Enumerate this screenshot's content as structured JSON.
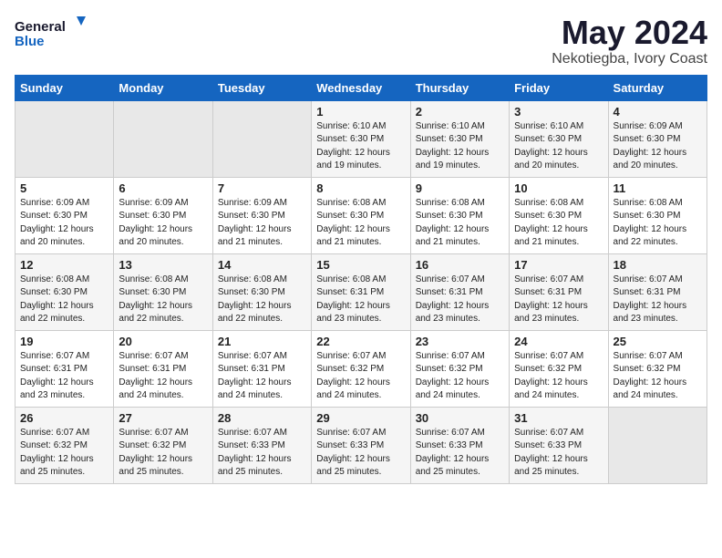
{
  "header": {
    "logo_line1": "General",
    "logo_line2": "Blue",
    "month": "May 2024",
    "location": "Nekotiegba, Ivory Coast"
  },
  "days_of_week": [
    "Sunday",
    "Monday",
    "Tuesday",
    "Wednesday",
    "Thursday",
    "Friday",
    "Saturday"
  ],
  "weeks": [
    [
      {
        "day": "",
        "text": ""
      },
      {
        "day": "",
        "text": ""
      },
      {
        "day": "",
        "text": ""
      },
      {
        "day": "1",
        "text": "Sunrise: 6:10 AM\nSunset: 6:30 PM\nDaylight: 12 hours\nand 19 minutes."
      },
      {
        "day": "2",
        "text": "Sunrise: 6:10 AM\nSunset: 6:30 PM\nDaylight: 12 hours\nand 19 minutes."
      },
      {
        "day": "3",
        "text": "Sunrise: 6:10 AM\nSunset: 6:30 PM\nDaylight: 12 hours\nand 20 minutes."
      },
      {
        "day": "4",
        "text": "Sunrise: 6:09 AM\nSunset: 6:30 PM\nDaylight: 12 hours\nand 20 minutes."
      }
    ],
    [
      {
        "day": "5",
        "text": "Sunrise: 6:09 AM\nSunset: 6:30 PM\nDaylight: 12 hours\nand 20 minutes."
      },
      {
        "day": "6",
        "text": "Sunrise: 6:09 AM\nSunset: 6:30 PM\nDaylight: 12 hours\nand 20 minutes."
      },
      {
        "day": "7",
        "text": "Sunrise: 6:09 AM\nSunset: 6:30 PM\nDaylight: 12 hours\nand 21 minutes."
      },
      {
        "day": "8",
        "text": "Sunrise: 6:08 AM\nSunset: 6:30 PM\nDaylight: 12 hours\nand 21 minutes."
      },
      {
        "day": "9",
        "text": "Sunrise: 6:08 AM\nSunset: 6:30 PM\nDaylight: 12 hours\nand 21 minutes."
      },
      {
        "day": "10",
        "text": "Sunrise: 6:08 AM\nSunset: 6:30 PM\nDaylight: 12 hours\nand 21 minutes."
      },
      {
        "day": "11",
        "text": "Sunrise: 6:08 AM\nSunset: 6:30 PM\nDaylight: 12 hours\nand 22 minutes."
      }
    ],
    [
      {
        "day": "12",
        "text": "Sunrise: 6:08 AM\nSunset: 6:30 PM\nDaylight: 12 hours\nand 22 minutes."
      },
      {
        "day": "13",
        "text": "Sunrise: 6:08 AM\nSunset: 6:30 PM\nDaylight: 12 hours\nand 22 minutes."
      },
      {
        "day": "14",
        "text": "Sunrise: 6:08 AM\nSunset: 6:30 PM\nDaylight: 12 hours\nand 22 minutes."
      },
      {
        "day": "15",
        "text": "Sunrise: 6:08 AM\nSunset: 6:31 PM\nDaylight: 12 hours\nand 23 minutes."
      },
      {
        "day": "16",
        "text": "Sunrise: 6:07 AM\nSunset: 6:31 PM\nDaylight: 12 hours\nand 23 minutes."
      },
      {
        "day": "17",
        "text": "Sunrise: 6:07 AM\nSunset: 6:31 PM\nDaylight: 12 hours\nand 23 minutes."
      },
      {
        "day": "18",
        "text": "Sunrise: 6:07 AM\nSunset: 6:31 PM\nDaylight: 12 hours\nand 23 minutes."
      }
    ],
    [
      {
        "day": "19",
        "text": "Sunrise: 6:07 AM\nSunset: 6:31 PM\nDaylight: 12 hours\nand 23 minutes."
      },
      {
        "day": "20",
        "text": "Sunrise: 6:07 AM\nSunset: 6:31 PM\nDaylight: 12 hours\nand 24 minutes."
      },
      {
        "day": "21",
        "text": "Sunrise: 6:07 AM\nSunset: 6:31 PM\nDaylight: 12 hours\nand 24 minutes."
      },
      {
        "day": "22",
        "text": "Sunrise: 6:07 AM\nSunset: 6:32 PM\nDaylight: 12 hours\nand 24 minutes."
      },
      {
        "day": "23",
        "text": "Sunrise: 6:07 AM\nSunset: 6:32 PM\nDaylight: 12 hours\nand 24 minutes."
      },
      {
        "day": "24",
        "text": "Sunrise: 6:07 AM\nSunset: 6:32 PM\nDaylight: 12 hours\nand 24 minutes."
      },
      {
        "day": "25",
        "text": "Sunrise: 6:07 AM\nSunset: 6:32 PM\nDaylight: 12 hours\nand 24 minutes."
      }
    ],
    [
      {
        "day": "26",
        "text": "Sunrise: 6:07 AM\nSunset: 6:32 PM\nDaylight: 12 hours\nand 25 minutes."
      },
      {
        "day": "27",
        "text": "Sunrise: 6:07 AM\nSunset: 6:32 PM\nDaylight: 12 hours\nand 25 minutes."
      },
      {
        "day": "28",
        "text": "Sunrise: 6:07 AM\nSunset: 6:33 PM\nDaylight: 12 hours\nand 25 minutes."
      },
      {
        "day": "29",
        "text": "Sunrise: 6:07 AM\nSunset: 6:33 PM\nDaylight: 12 hours\nand 25 minutes."
      },
      {
        "day": "30",
        "text": "Sunrise: 6:07 AM\nSunset: 6:33 PM\nDaylight: 12 hours\nand 25 minutes."
      },
      {
        "day": "31",
        "text": "Sunrise: 6:07 AM\nSunset: 6:33 PM\nDaylight: 12 hours\nand 25 minutes."
      },
      {
        "day": "",
        "text": ""
      }
    ]
  ]
}
